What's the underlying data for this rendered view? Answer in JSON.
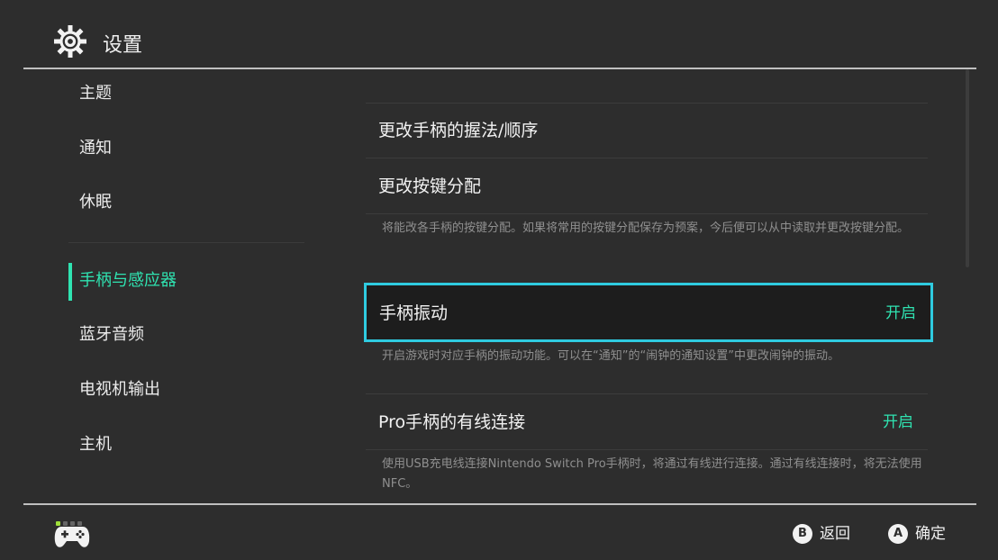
{
  "header": {
    "title": "设置"
  },
  "sidebar": {
    "items": [
      {
        "label": "主题"
      },
      {
        "label": "通知"
      },
      {
        "label": "休眠"
      },
      {
        "label": "手柄与感应器",
        "active": true
      },
      {
        "label": "蓝牙音频"
      },
      {
        "label": "电视机输出"
      },
      {
        "label": "主机"
      }
    ]
  },
  "content": {
    "rows": [
      {
        "label": "更改手柄的握法/顺序"
      },
      {
        "label": "更改按键分配",
        "description": "将能改各手柄的按键分配。如果将常用的按键分配保存为预案，今后便可以从中读取并更改按键分配。"
      },
      {
        "label": "手柄振动",
        "value": "开启",
        "focused": true,
        "description": "开启游戏时对应手柄的振动功能。可以在“通知”的“闹钟的通知设置”中更改闹钟的振动。"
      },
      {
        "label": "Pro手柄的有线连接",
        "value": "开启",
        "description": "使用USB充电线连接Nintendo Switch Pro手柄时，将通过有线进行连接。通过有线连接时，将无法使用NFC。"
      }
    ]
  },
  "footer": {
    "back": {
      "button": "B",
      "label": "返回"
    },
    "confirm": {
      "button": "A",
      "label": "确定"
    }
  },
  "colors": {
    "accent": "#2fe3b1",
    "focus_border": "#2fcbe0",
    "background": "#2d2d2d"
  }
}
